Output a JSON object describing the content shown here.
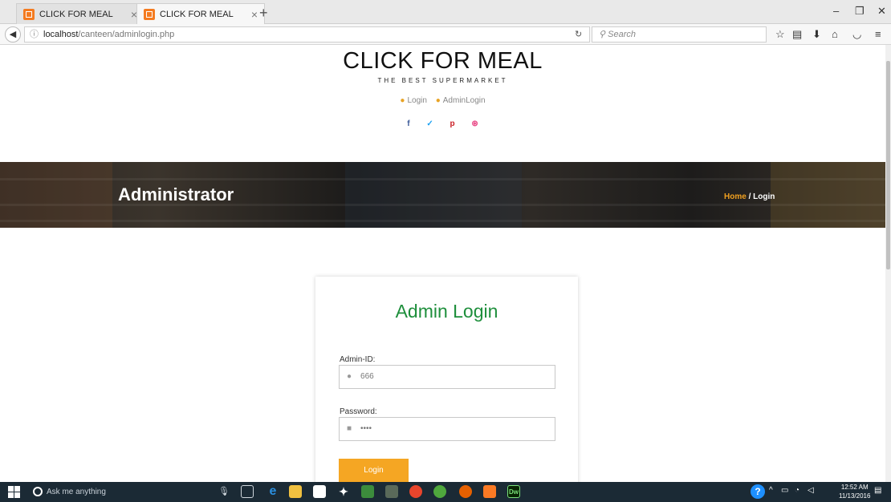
{
  "browser": {
    "tabs": [
      {
        "label": "CLICK FOR MEAL",
        "active": false
      },
      {
        "label": "CLICK FOR MEAL",
        "active": true
      }
    ],
    "new_tab": "+",
    "url_host": "localhost",
    "url_path": "/canteen/adminlogin.php",
    "search_placeholder": "Search"
  },
  "header": {
    "brand": "CLICK FOR MEAL",
    "tagline": "THE BEST SUPERMARKET",
    "links": [
      "Login",
      "AdminLogin"
    ],
    "social_icons": [
      "facebook-icon",
      "twitter-icon",
      "pinterest-icon",
      "dribbble-icon"
    ]
  },
  "banner": {
    "title": "Administrator",
    "breadcrumb_home": "Home",
    "breadcrumb_separator": " / ",
    "breadcrumb_current": "Login"
  },
  "login": {
    "title": "Admin Login",
    "admin_id_label": "Admin-ID:",
    "admin_id_value": "666",
    "password_label": "Password:",
    "password_value": "••••",
    "button_label": "Login"
  },
  "taskbar": {
    "search_placeholder": "Ask me anything",
    "time": "12:52 AM",
    "date": "11/13/2016",
    "pinned": [
      "task-view",
      "edge",
      "file-explorer",
      "store",
      "dropbox",
      "app-green",
      "app-grey",
      "chrome",
      "utorrent",
      "firefox",
      "xampp",
      "dreamweaver"
    ]
  },
  "colors": {
    "accent_orange": "#f5a623",
    "title_green": "#1e8f3c",
    "breadcrumb_home": "#f0a020",
    "facebook": "#3b5998",
    "twitter": "#1da1f2",
    "pinterest": "#cb2027",
    "dribbble": "#ea4c89"
  }
}
